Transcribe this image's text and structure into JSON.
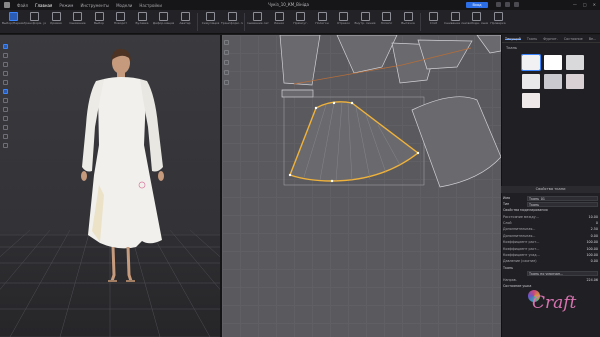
{
  "window": {
    "title": "Чукіз_10_КМ_Вініда",
    "menu": [
      "Файл",
      "Главная",
      "Режим",
      "Инструменты",
      "Модели",
      "Настройки"
    ],
    "top_badge": "Вход",
    "controls": [
      "—",
      "□",
      "✕"
    ]
  },
  "toolbar": {
    "tools": [
      {
        "label": "Выбор/Переме-щение",
        "active": true
      },
      {
        "label": "Трансформ. узла",
        "active": false
      },
      {
        "label": "Кривая",
        "active": false
      },
      {
        "label": "Сшивание",
        "active": false
      },
      {
        "label": "Выбор",
        "active": false
      },
      {
        "label": "Поворот",
        "active": false
      },
      {
        "label": "Булавка",
        "active": false
      },
      {
        "label": "Дефор-мация",
        "active": false
      },
      {
        "label": "Аватар",
        "active": false
      },
      {
        "label": "Симуляция",
        "active": false
      },
      {
        "label": "Трансформ. лекала",
        "active": false
      },
      {
        "label": "Сшивание сегм.",
        "active": false
      },
      {
        "label": "Линия",
        "active": false
      },
      {
        "label": "Прямоуг.",
        "active": false
      },
      {
        "label": "Полигон",
        "active": false
      },
      {
        "label": "Отрезок",
        "active": false
      },
      {
        "label": "Внутр. линия",
        "active": false
      },
      {
        "label": "Эллипс",
        "active": false
      },
      {
        "label": "Вытачка",
        "active": false
      },
      {
        "label": "Сгиб",
        "active": false
      },
      {
        "label": "Сшивание лекал",
        "active": false
      },
      {
        "label": "Свободн. сшив.",
        "active": false
      },
      {
        "label": "Проверка",
        "active": false
      }
    ]
  },
  "colors": {
    "accent": "#3b86ff",
    "highlight_outline": "#f0b23a",
    "piece_fill": "#6a6a6e",
    "piece_outline": "#d2d2d6",
    "dress": "#f2f0ec",
    "watermark": "#d872b0"
  },
  "right_panel": {
    "tabs": [
      "Текущий",
      "Ткань",
      "Фурнит.",
      "Состояние",
      "Ве..."
    ],
    "active_tab": 0,
    "section": "Ткань",
    "swatches": [
      "#f1f1f3",
      "#ffffff",
      "#d9d9dc",
      "#e8e8ea",
      "#c9c9cf",
      "#d8d0d2",
      "#efe8e9"
    ],
    "properties_title": "Свойства ткани",
    "name_label": "Имя",
    "name_value": "Ткань_01",
    "type_label": "Тип",
    "type_value": "Ткань",
    "sim_header": "Свойства моделирования",
    "props": [
      {
        "label": "Расстояние между...",
        "value": "10.00"
      },
      {
        "label": "Слой",
        "value": "0"
      },
      {
        "label": "Дополнительная...",
        "value": "2.50"
      },
      {
        "label": "Дополнительная...",
        "value": "0.00"
      },
      {
        "label": "Коэффициент раст...",
        "value": "100.00"
      },
      {
        "label": "Коэффициент раст...",
        "value": "100.00"
      },
      {
        "label": "Коэффициент усад...",
        "value": "100.00"
      },
      {
        "label": "Давление (сжатие)",
        "value": "0.00"
      }
    ],
    "fabric_header": "Ткань",
    "fabric_select": "Ткань по умолчан...",
    "direction_label": "Направ.",
    "direction_value": "224.06",
    "state_header": "Состояние ушка"
  },
  "watermark": "Craft"
}
